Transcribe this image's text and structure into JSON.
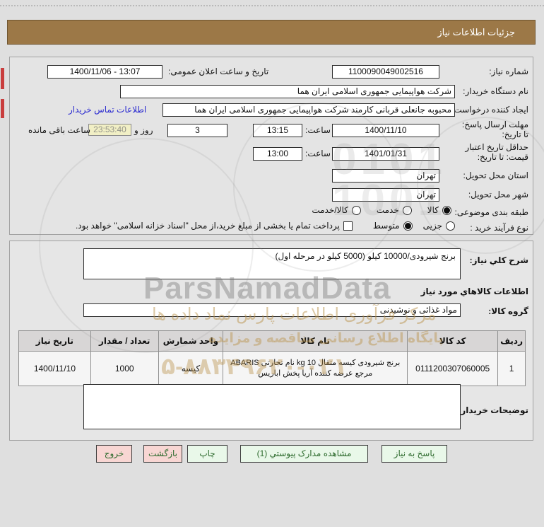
{
  "page": {
    "background": "#dfdfdf",
    "titlebar_color": "#9c7847"
  },
  "header": {
    "title": "جزئیات اطلاعات نیاز"
  },
  "form": {
    "need_number": {
      "label": "شماره نیاز:",
      "value": "1100090049002516"
    },
    "announce": {
      "label": "تاریخ و ساعت اعلان عمومی:",
      "value": "1400/11/06 - 13:07"
    },
    "buyer_org": {
      "label": "نام دستگاه خریدار:",
      "value": "شرکت هواپیمایی جمهوری اسلامی ایران هما"
    },
    "creator": {
      "label": "ایجاد کننده درخواست:",
      "value": "محبوبه جانعلی قربانی کارمند شرکت هواپیمایی جمهوری اسلامی ایران هما",
      "contact_link": "اطلاعات تماس خریدار"
    },
    "deadline": {
      "label": "مهلت ارسال پاسخ: تا تاریخ:",
      "date": "1400/11/10",
      "time_label": "ساعت:",
      "time": "13:15",
      "days": "3",
      "days_label": "روز و",
      "countdown": "23:53:40",
      "remaining_label": "ساعت باقی مانده"
    },
    "validity": {
      "label": "حداقل تاریخ اعتبار قیمت: تا تاریخ:",
      "date": "1401/01/31",
      "time_label": "ساعت:",
      "time": "13:00"
    },
    "province": {
      "label": "استان محل تحویل:",
      "value": "تهران"
    },
    "city": {
      "label": "شهر محل تحویل:",
      "value": "تهران"
    },
    "classification": {
      "label": "طبقه بندی موضوعی:",
      "options": [
        {
          "label": "کالا",
          "checked": true
        },
        {
          "label": "خدمت",
          "checked": false
        },
        {
          "label": "کالا/خدمت",
          "checked": false
        }
      ]
    },
    "process": {
      "label": "نوع فرآیند خرید :",
      "options": [
        {
          "label": "جزیی",
          "checked": false
        },
        {
          "label": "متوسط",
          "checked": true
        }
      ],
      "checkbox_label": "پرداخت تمام یا بخشی از مبلغ خرید،از محل \"اسناد خزانه اسلامی\" خواهد بود.",
      "checkbox_checked": false
    }
  },
  "details": {
    "desc_label": "شرح كلي نیاز:",
    "desc_value": "برنج شیرودی/10000 کیلو (5000 کیلو در مرحله اول)",
    "goods_heading": "اطلاعات كالاهاي مورد نیاز",
    "group_label": "گروه کالا:",
    "group_value": "مواد غذائی و نوشیدنی",
    "table": {
      "headers": [
        "ردیف",
        "کد کالا",
        "نام کالا",
        "واحد شمارش",
        "تعداد / مقدار",
        "تاریخ نیاز"
      ],
      "rows": [
        [
          "1",
          "0111200307060005",
          "برنج شیرودی کیسه متقال 10 kg نام تجارتی ABARIS مرجع عرضه کننده آریا پخش اباریس",
          "کیسه",
          "1000",
          "1400/11/10"
        ]
      ]
    },
    "notes_label": "توضیحات خریدار:",
    "notes_value": ""
  },
  "buttons": {
    "respond": "پاسخ به نیاز",
    "attachments": "مشاهده مدارک پیوستي (1)",
    "print": "چاپ",
    "back": "بازگشت",
    "exit": "خروج"
  },
  "watermark": {
    "brand": "ParsNamadData",
    "calligraphy": "مرکز فرآوری اطلاعات پارس نماد داده ها",
    "tagline": "پایگاه اطلاع رسانی مناقصه و مزایده",
    "phone": "۵-۸۸۳۴۹۶۲۰-۰۲۱",
    "digits1": "0101",
    "digits2": "1001"
  }
}
